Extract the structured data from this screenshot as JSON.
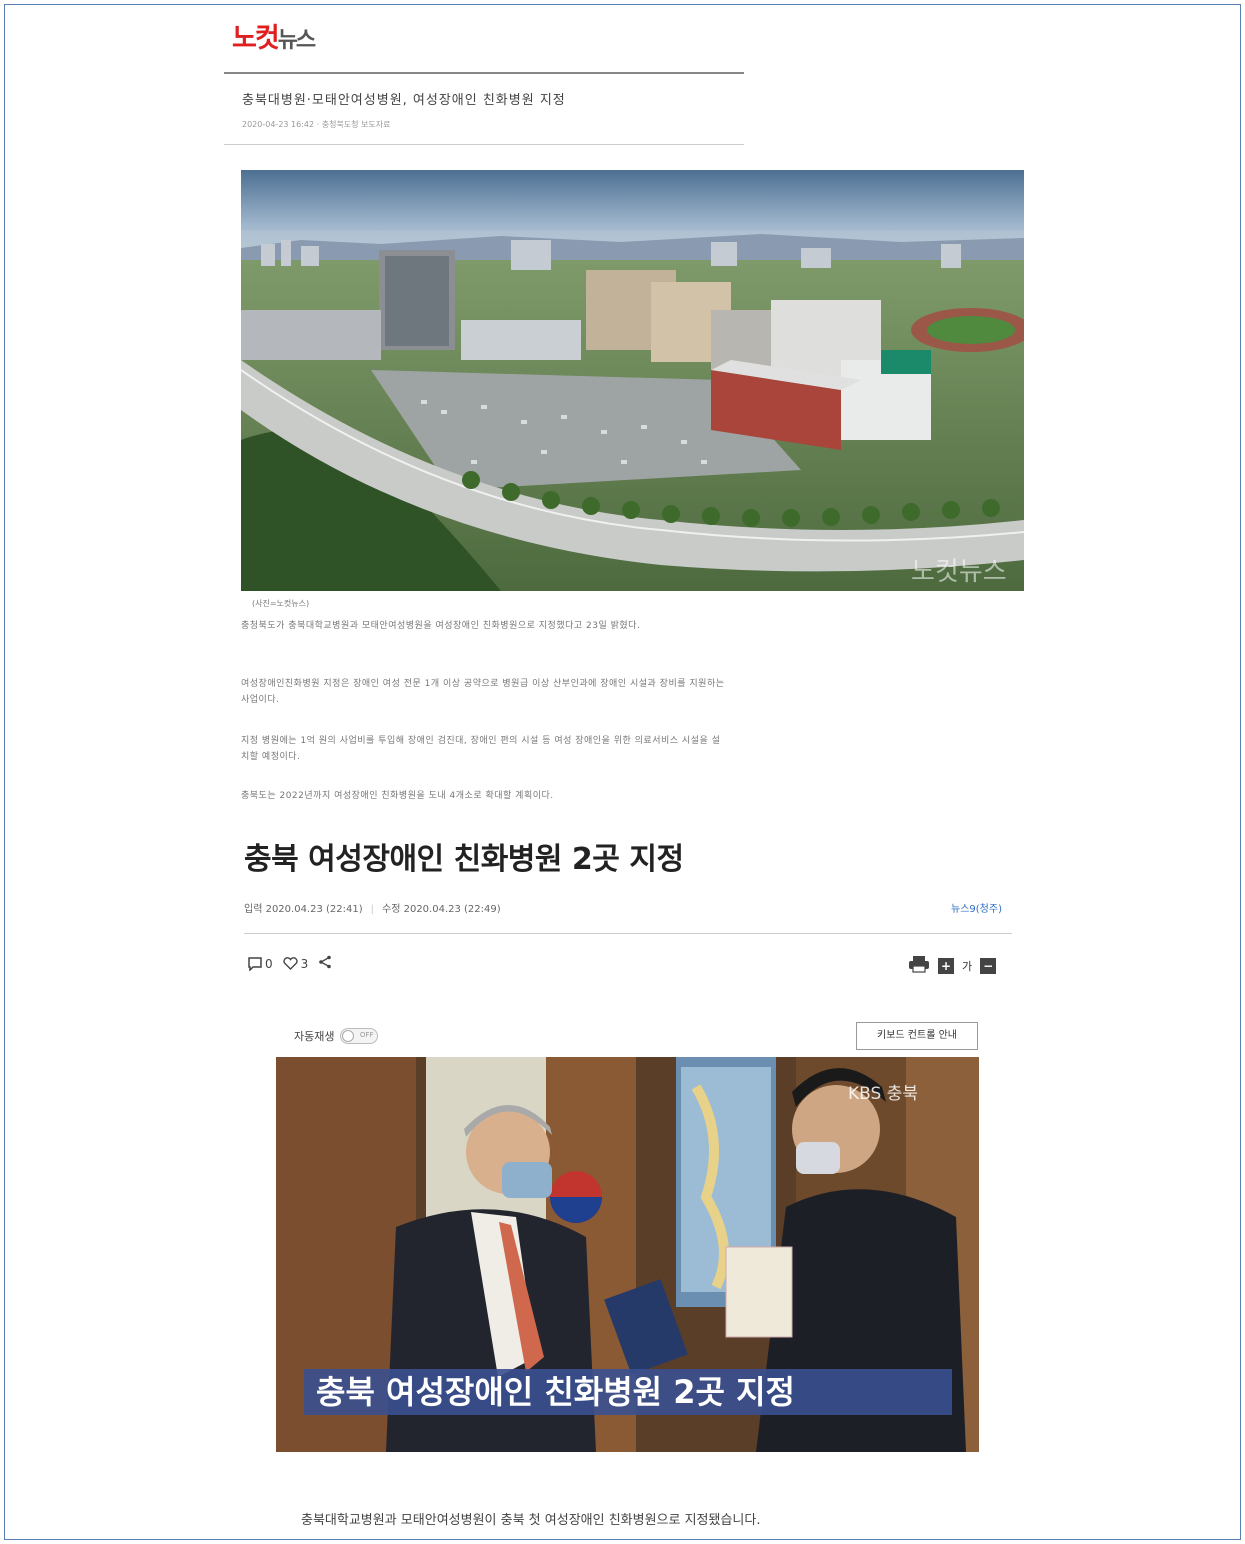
{
  "header": {
    "logo_red": "노컷",
    "logo_gray": "뉴스"
  },
  "clip": {
    "title": "충북대병원·모태안여성병원, 여성장애인 친화병원 지정",
    "date_line": "2020-04-23 16:42 · 충청북도청 보도자료",
    "photo_caption": "(사진=노컷뉴스)",
    "watermark": "노컷뉴스",
    "paragraphs": [
      "충청북도가 충북대학교병원과 모태안여성병원을 여성장애인 친화병원으로 지정했다고 23일 밝혔다.",
      "여성장애인친화병원 지정은 장애인 여성 전문 1개 이상 공약으로 병원급 이상 산부인과에 장애인 시설과 장비를 지원하는 사업이다.",
      "지정 병원에는 1억 원의 사업비를 투입해 장애인 검진대, 장애인 편의 시설 등 여성 장애인을 위한 의료서비스 시설을 설치할 예정이다.",
      "충북도는 2022년까지 여성장애인 친화병원을 도내 4개소로 확대할 계획이다."
    ]
  },
  "article": {
    "title": "충북 여성장애인 친화병원 2곳 지정",
    "input_date": "입력 2020.04.23 (22:41)",
    "modified_date": "수정 2020.04.23 (22:49)",
    "source": "뉴스9(청주)",
    "comment_count": "0",
    "like_count": "3",
    "font_size_label": "가",
    "autoplay_label": "자동재생",
    "autoplay_state": "OFF",
    "keyboard_guide": "키보드 컨트롤 안내",
    "video_logo": "KBS 충북",
    "video_caption": "충북 여성장애인 친화병원 2곳 지정",
    "lead": "충북대학교병원과 모태안여성병원이 충북 첫 여성장애인 친화병원으로 지정됐습니다."
  },
  "icons": {
    "comment": "comment-icon",
    "like": "heart-icon",
    "share": "share-icon",
    "print": "print-icon",
    "font_up": "font-increase-icon",
    "font_down": "font-decrease-icon"
  },
  "colors": {
    "logo_red": "#e02020",
    "link_blue": "#2d6fc7",
    "caption_bar": "#3a5090"
  }
}
